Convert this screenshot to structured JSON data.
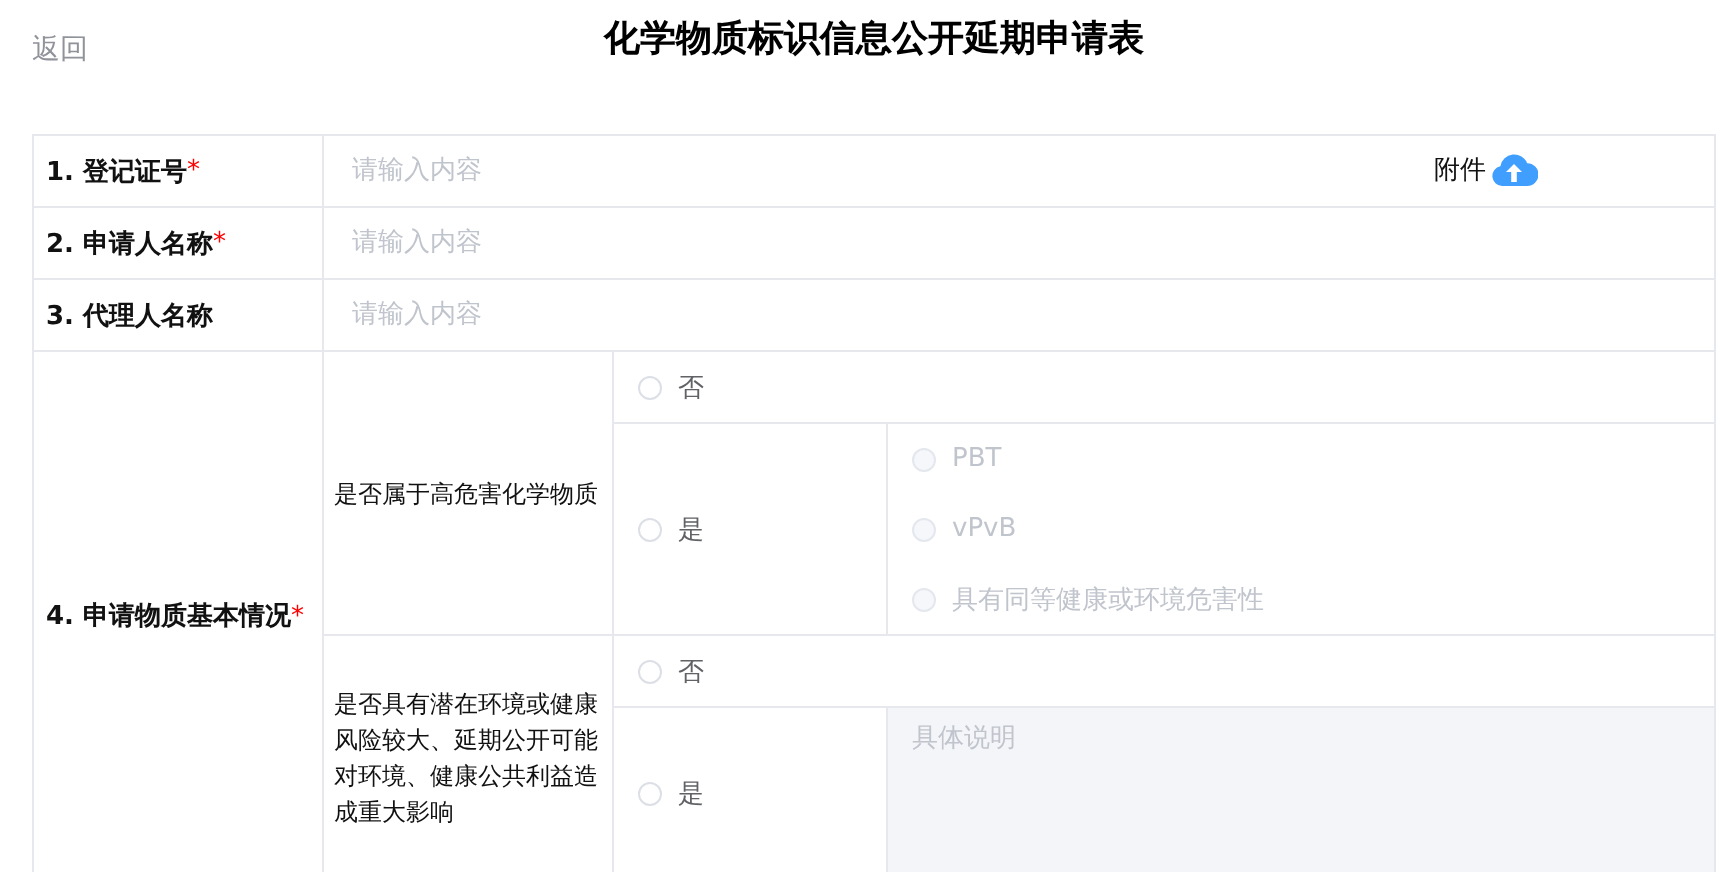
{
  "back_link": "返回",
  "title": "化学物质标识信息公开延期申请表",
  "fields": [
    {
      "label": "1. 登记证号",
      "required_mark": "*",
      "placeholder": "请输入内容",
      "attachment": {
        "label": "附件"
      }
    },
    {
      "label": "2. 申请人名称",
      "required_mark": "*",
      "placeholder": "请输入内容"
    },
    {
      "label": "3. 代理人名称",
      "placeholder": "请输入内容"
    }
  ],
  "basic_info": {
    "label": "4. 申请物质基本情况",
    "required_mark": "*",
    "questions": [
      {
        "question": "是否属于高危害化学物质",
        "options": [
          {
            "label": "否",
            "selected": false,
            "kind": "plain"
          },
          {
            "label": "是",
            "selected": false,
            "kind": "suboptions",
            "suboptions": [
              {
                "label": "PBT",
                "selected": false,
                "disabled": true
              },
              {
                "label": "vPvB",
                "selected": false,
                "disabled": true
              },
              {
                "label": "具有同等健康或环境危害性",
                "selected": false,
                "disabled": true
              }
            ]
          }
        ]
      },
      {
        "question": "是否具有潜在环境或健康风险较大、延期公开可能对环境、健康公共利益造成重大影响",
        "options": [
          {
            "label": "否",
            "selected": false,
            "kind": "plain"
          },
          {
            "label": "是",
            "selected": false,
            "kind": "explanation",
            "placeholder": "具体说明"
          }
        ]
      }
    ]
  }
}
